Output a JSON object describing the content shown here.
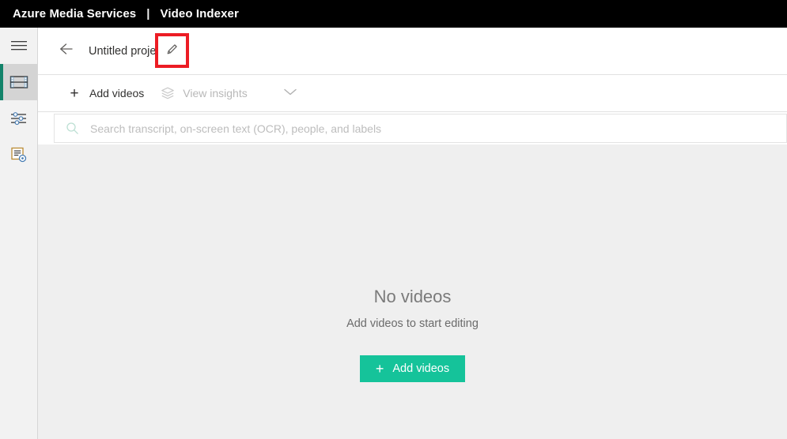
{
  "topbar": {
    "product": "Azure Media Services",
    "separator": "|",
    "section": "Video Indexer"
  },
  "rail": {
    "items": [
      {
        "name": "hamburger-menu",
        "icon": "hamburger-icon",
        "active": false
      },
      {
        "name": "media-library",
        "icon": "film-strip-icon",
        "active": true
      },
      {
        "name": "customization",
        "icon": "sliders-icon",
        "active": false
      },
      {
        "name": "model-customization",
        "icon": "document-gear-icon",
        "active": false
      }
    ]
  },
  "project_header": {
    "back_icon": "back-arrow-icon",
    "title": "Untitled project",
    "edit_icon": "pencil-icon",
    "highlight_color": "#ec1c24"
  },
  "toolbar": {
    "add_videos_label": "Add videos",
    "add_videos_icon": "plus-icon",
    "view_insights_label": "View insights",
    "view_insights_icon": "layers-icon",
    "view_insights_disabled": true,
    "chevron_icon": "chevron-down-icon"
  },
  "search": {
    "icon": "search-icon",
    "value": "",
    "placeholder": "Search transcript, on-screen text (OCR), people, and labels"
  },
  "empty_state": {
    "title": "No videos",
    "subtitle": "Add videos to start editing",
    "cta_plus": "+",
    "cta_label": "Add videos",
    "cta_color": "#15c39a"
  },
  "colors": {
    "accent_teal": "#12836a",
    "brand_green": "#15c39a",
    "highlight_red": "#ec1c24",
    "page_bg": "#efefef"
  }
}
